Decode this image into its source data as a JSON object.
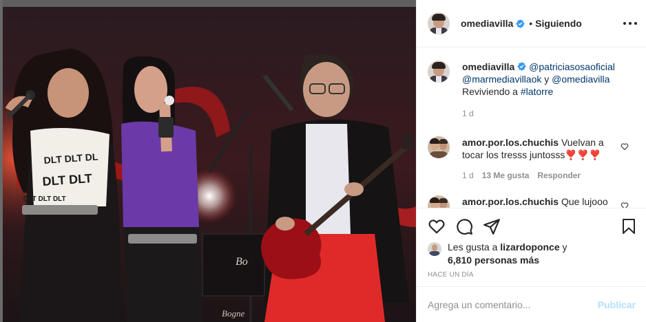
{
  "post": {
    "author": "omediavilla",
    "follow_status": "Siguiendo",
    "separator": "•"
  },
  "caption": {
    "username": "omediavilla",
    "mention_1": "@patriciasosaoficial",
    "mention_2": "@marmediavillaok",
    "connector": "y",
    "mention_3": "@omediavilla",
    "text_prefix": "Reviviendo a",
    "hashtag": "#latorre",
    "time": "1 d"
  },
  "comments": [
    {
      "username": "amor.por.los.chuchis",
      "text": "Vuelvan a tocar los tresss juntosss❣️❣️❣️",
      "time": "1 d",
      "likes": "13 Me gusta",
      "reply": "Responder"
    },
    {
      "username": "amor.por.los.chuchis",
      "text": "Que lujooo"
    }
  ],
  "likes": {
    "prefix": "Les gusta a",
    "user": "lizardoponce",
    "connector": "y",
    "others": "6,810 personas más"
  },
  "timestamp": "Hace un día",
  "add_comment": {
    "placeholder": "Agrega un comentario...",
    "publish": "Publicar"
  },
  "photo_text": {
    "shirt_text_1": "DLT DLT DL",
    "shirt_text_2": "DLT DLT",
    "shirt_text_3": "DLT DLT DLT",
    "amp_brand": "Bo",
    "amp_brand_2": "Bogne"
  },
  "colors": {
    "verified": "#3897f0",
    "link": "#00376b",
    "muted": "#8e8e8e",
    "publish_disabled": "#b2dffc",
    "stage_red": "#c81e1e"
  },
  "icons": [
    "verified-badge-icon",
    "more-options-icon",
    "heart-icon",
    "comment-icon",
    "share-icon",
    "bookmark-icon",
    "small-heart-icon"
  ]
}
